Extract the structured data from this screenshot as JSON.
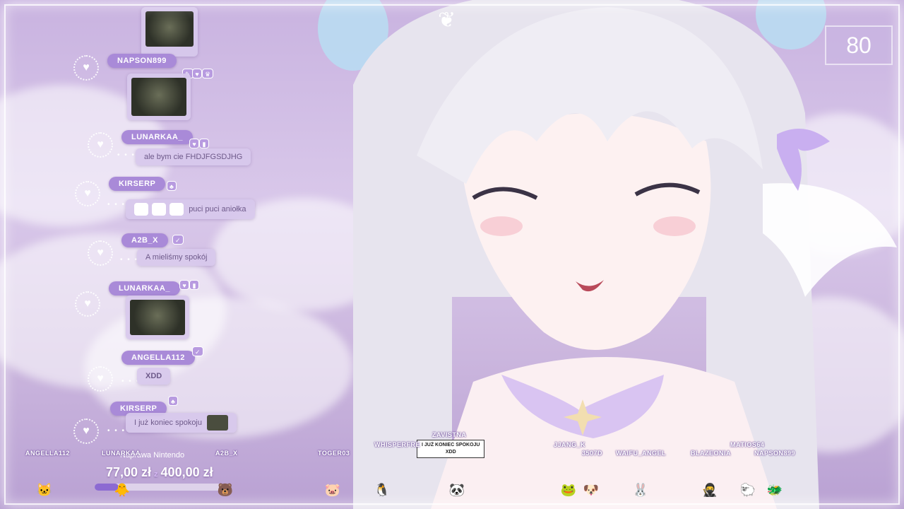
{
  "counter": "80",
  "chat": [
    {
      "user": "NAPSON899",
      "badges": [
        "✎",
        "♥",
        "♛"
      ],
      "type": "image"
    },
    {
      "user": "LUNARKAA_",
      "badges": [
        "♥",
        "▮"
      ],
      "type": "text",
      "text": "ale bym cie FHDJFGSDJHG"
    },
    {
      "user": "KIRSERP",
      "badges": [
        "♣"
      ],
      "type": "text",
      "text": "puci puci aniołka"
    },
    {
      "user": "A2B_X",
      "badges": [
        "✓"
      ],
      "type": "text",
      "text": "A mieliśmy spokój"
    },
    {
      "user": "LUNARKAA_",
      "badges": [
        "♥",
        "▮"
      ],
      "type": "image"
    },
    {
      "user": "ANGELLA112",
      "badges": [
        "✓"
      ],
      "type": "text",
      "text": "XDD"
    },
    {
      "user": "KIRSERP",
      "badges": [
        "♣"
      ],
      "type": "text",
      "text": "I już koniec spokoju"
    }
  ],
  "goal": {
    "title": "Naprawa Nintendo",
    "current": "77,00 zł",
    "target": "400,00 zł",
    "progress_percent": 19
  },
  "speech_bubble": {
    "line1": "I JUŻ KONIEC SPOKOJU",
    "line2": "XDD"
  },
  "viewers": [
    {
      "name": "ANGELLA112",
      "icon": "🐱"
    },
    {
      "name": "LUNARKAA",
      "icon": "🐥"
    },
    {
      "name": "A2B_X",
      "icon": "🐻"
    },
    {
      "name": "TOGER03",
      "icon": "🐷"
    },
    {
      "name": "WHISPERFRE",
      "icon": "🐧"
    },
    {
      "name": "ZAVISTNA",
      "icon": "🐼"
    },
    {
      "name": "JJANG_K",
      "icon": "🐸"
    },
    {
      "name": "3507D",
      "icon": "🐶"
    },
    {
      "name": "WAIFU_ANGEL",
      "icon": "🐰"
    },
    {
      "name": "BLAZEONIA",
      "icon": "🥷"
    },
    {
      "name": "MATIOS64",
      "icon": "🐑"
    },
    {
      "name": "NAPSON899",
      "icon": "🐲"
    }
  ],
  "colors": {
    "accent": "#a98ad8",
    "background": "#d9c8ea",
    "goal_fill": "#8c6ad2"
  }
}
